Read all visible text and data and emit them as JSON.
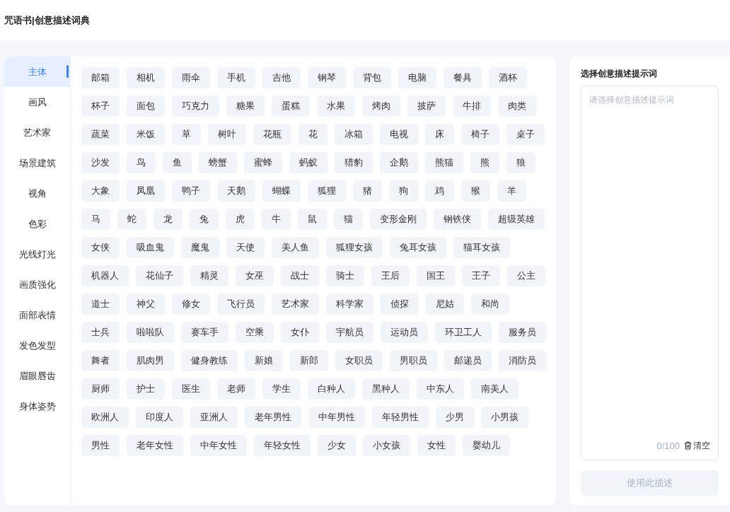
{
  "header": {
    "title": "咒语书|创意描述词典"
  },
  "categories": [
    {
      "label": "主体",
      "selected": true
    },
    {
      "label": "画风",
      "selected": false
    },
    {
      "label": "艺术家",
      "selected": false
    },
    {
      "label": "场景建筑",
      "selected": false
    },
    {
      "label": "视角",
      "selected": false
    },
    {
      "label": "色彩",
      "selected": false
    },
    {
      "label": "光线灯光",
      "selected": false
    },
    {
      "label": "画质强化",
      "selected": false
    },
    {
      "label": "面部表情",
      "selected": false
    },
    {
      "label": "发色发型",
      "selected": false
    },
    {
      "label": "眉眼唇齿",
      "selected": false
    },
    {
      "label": "身体姿势",
      "selected": false
    }
  ],
  "tags": [
    "邮箱",
    "相机",
    "雨伞",
    "手机",
    "吉他",
    "钢琴",
    "背包",
    "电脑",
    "餐具",
    "酒杯",
    "杯子",
    "面包",
    "巧克力",
    "糖果",
    "蛋糕",
    "水果",
    "烤肉",
    "披萨",
    "牛排",
    "肉类",
    "蔬菜",
    "米饭",
    "草",
    "树叶",
    "花瓶",
    "花",
    "冰箱",
    "电视",
    "床",
    "椅子",
    "桌子",
    "沙发",
    "鸟",
    "鱼",
    "螃蟹",
    "蜜蜂",
    "蚂蚁",
    "猎豹",
    "企鹅",
    "熊猫",
    "熊",
    "狼",
    "大象",
    "凤凰",
    "鸭子",
    "天鹅",
    "蝴蝶",
    "狐狸",
    "猪",
    "狗",
    "鸡",
    "猴",
    "羊",
    "马",
    "蛇",
    "龙",
    "兔",
    "虎",
    "牛",
    "鼠",
    "猫",
    "变形金刚",
    "钢铁侠",
    "超级英雄",
    "女侠",
    "吸血鬼",
    "魔鬼",
    "天使",
    "美人鱼",
    "狐狸女孩",
    "兔耳女孩",
    "猫耳女孩",
    "机器人",
    "花仙子",
    "精灵",
    "女巫",
    "战士",
    "骑士",
    "王后",
    "国王",
    "王子",
    "公主",
    "道士",
    "神父",
    "修女",
    "飞行员",
    "艺术家",
    "科学家",
    "侦探",
    "尼姑",
    "和尚",
    "士兵",
    "啦啦队",
    "赛车手",
    "空乘",
    "女仆",
    "宇航员",
    "运动员",
    "环卫工人",
    "服务员",
    "舞者",
    "肌肉男",
    "健身教练",
    "新娘",
    "新郎",
    "女职员",
    "男职员",
    "邮递员",
    "消防员",
    "厨师",
    "护士",
    "医生",
    "老师",
    "学生",
    "白种人",
    "黑种人",
    "中东人",
    "南美人",
    "欧洲人",
    "印度人",
    "亚洲人",
    "老年男性",
    "中年男性",
    "年轻男性",
    "少男",
    "小男孩",
    "男性",
    "老年女性",
    "中年女性",
    "年轻女性",
    "少女",
    "小女孩",
    "女性",
    "婴幼儿"
  ],
  "panel": {
    "title": "选择创意描述提示词",
    "placeholder": "请选择创意描述提示词",
    "counter": "0/100",
    "clear_label": "清空",
    "submit": {
      "label": "使用此描述",
      "disabled": true
    }
  }
}
